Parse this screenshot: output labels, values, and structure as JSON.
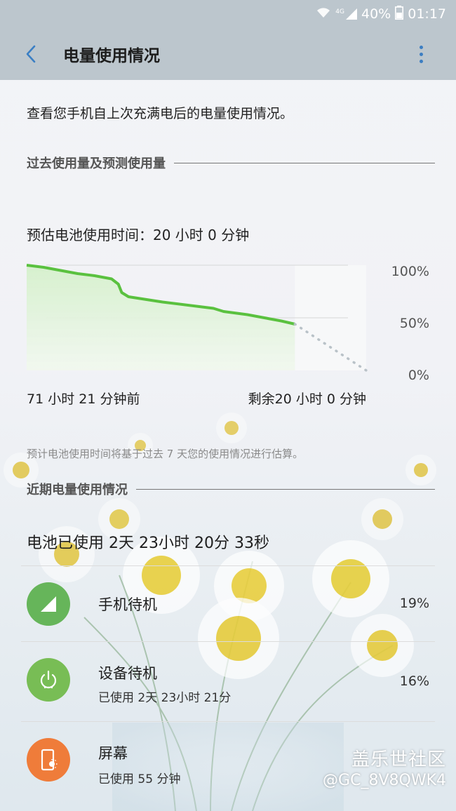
{
  "status_bar": {
    "battery_percent": "40%",
    "time": "01:17",
    "signal_label": "4G"
  },
  "app_bar": {
    "title": "电量使用情况"
  },
  "intro_text": "查看您手机自上次充满电后的电量使用情况。",
  "section_past": {
    "title": "过去使用量及预测使用量"
  },
  "estimate_text": "预估电池使用时间：20 小时 0 分钟",
  "chart_data": {
    "type": "line",
    "y_tick_labels": [
      "100%",
      "50%",
      "0%"
    ],
    "ylim": [
      0,
      100
    ],
    "x_start_label": "71 小时 21 分钟前",
    "x_end_label": "剩余20 小时 0 分钟",
    "series": [
      {
        "x": [
          0,
          5,
          10,
          15,
          20,
          25,
          27,
          28,
          30,
          40,
          50,
          55,
          58,
          65,
          70,
          75,
          79
        ],
        "values": [
          100,
          98,
          95,
          92,
          90,
          87,
          82,
          74,
          70,
          65,
          61,
          59,
          56,
          53,
          50,
          47,
          44
        ]
      },
      {
        "x": [
          79,
          100
        ],
        "values": [
          44,
          0
        ],
        "dashed": true
      }
    ],
    "colors": {
      "line": "#5ac13f",
      "fill_top": "#cfeec7",
      "dotted": "#b9c2c8",
      "grid": "#d7d7d7"
    }
  },
  "note_text": "预计电池使用时间将基于过去 7 天您的使用情况进行估算。",
  "section_recent": {
    "title": "近期电量使用情况"
  },
  "battery_used_text": "电池已使用 2天 23小时 20分 33秒",
  "usage_items": [
    {
      "name": "手机待机",
      "sub": "",
      "percent": "19%",
      "icon": "signal-icon",
      "color": "#66b55a"
    },
    {
      "name": "设备待机",
      "sub": "已使用 2天 23小时 21分",
      "percent": "16%",
      "icon": "power-icon",
      "color": "#78bd55"
    },
    {
      "name": "屏幕",
      "sub": "已使用 55 分钟",
      "percent": "",
      "icon": "screen-brightness-icon",
      "color": "#ef7c3a"
    }
  ],
  "watermark": {
    "line1": "盖乐世社区",
    "line2": "@GC_8V8QWK4"
  }
}
